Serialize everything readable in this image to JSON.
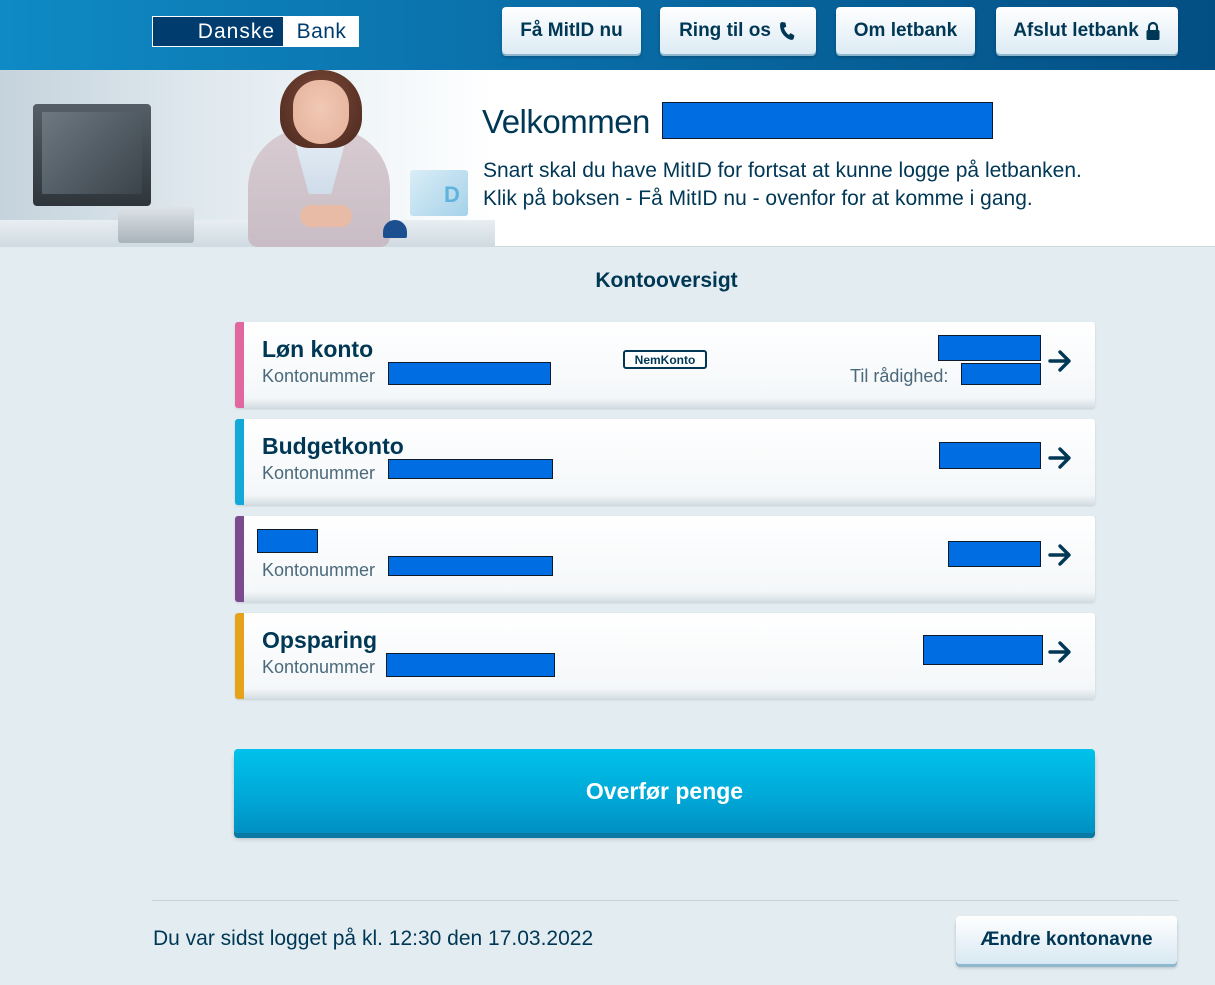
{
  "colors": {
    "brand": "#003c6e",
    "accent": "#00b2e3",
    "redaction": "#006de3",
    "account_pink": "#e0679f",
    "account_blue": "#12a8d8",
    "account_purple": "#7b4a8f",
    "account_orange": "#e6a21b"
  },
  "header": {
    "logo_left": "Danske",
    "logo_right": "Bank",
    "buttons": [
      {
        "label": "Få MitID nu",
        "icon": ""
      },
      {
        "label": "Ring til os",
        "icon": "phone-icon"
      },
      {
        "label": "Om letbank",
        "icon": ""
      },
      {
        "label": "Afslut letbank",
        "icon": "lock-icon"
      }
    ]
  },
  "hero": {
    "title": "Velkommen",
    "message_line1": "Snart skal du have MitID for fortsat at kunne logge på letbanken.",
    "message_line2": "Klik på boksen - Få MitID nu - ovenfor for at komme i gang.",
    "image_decor_letter": "D"
  },
  "overview": {
    "title": "Kontooversigt",
    "account_number_label": "Kontonummer",
    "available_label": "Til rådighed:",
    "nemkonto_badge": "NemKonto",
    "accounts": [
      {
        "name": "Løn konto"
      },
      {
        "name": "Budgetkonto"
      },
      {
        "name": ""
      },
      {
        "name": "Opsparing"
      }
    ]
  },
  "actions": {
    "transfer_label": "Overfør penge",
    "rename_label": "Ændre kontonavne"
  },
  "footer": {
    "last_login": "Du var sidst logget på kl. 12:30 den 17.03.2022"
  }
}
